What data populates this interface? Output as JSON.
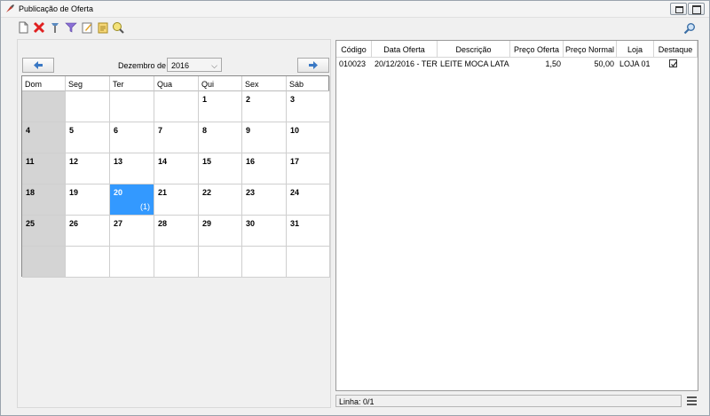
{
  "window": {
    "title": "Publicação de Oferta"
  },
  "toolbar": {
    "icons": [
      "new-document-icon",
      "delete-icon",
      "tools-icon",
      "filter-icon",
      "edit-icon",
      "export-icon",
      "search-settings-icon"
    ]
  },
  "calendar": {
    "month_label": "Dezembro de",
    "year": "2016",
    "day_headers": [
      "Dom",
      "Seg",
      "Ter",
      "Qua",
      "Qui",
      "Sex",
      "Sáb"
    ],
    "weeks": [
      [
        "",
        "",
        "",
        "",
        "1",
        "2",
        "3"
      ],
      [
        "4",
        "5",
        "6",
        "7",
        "8",
        "9",
        "10"
      ],
      [
        "11",
        "12",
        "13",
        "14",
        "15",
        "16",
        "17"
      ],
      [
        "18",
        "19",
        "20",
        "21",
        "22",
        "23",
        "24"
      ],
      [
        "25",
        "26",
        "27",
        "28",
        "29",
        "30",
        "31"
      ],
      [
        "",
        "",
        "",
        "",
        "",
        "",
        ""
      ]
    ],
    "selected_day": "20",
    "selected_count": "(1)",
    "colors": {
      "weekend_bg": "#d4d4d4",
      "selected_bg": "#3399ff"
    }
  },
  "grid": {
    "columns": [
      "Código",
      "Data Oferta",
      "Descrição",
      "Preço Oferta",
      "Preço Normal",
      "Loja",
      "Destaque"
    ],
    "rows": [
      {
        "codigo": "010023",
        "data": "20/12/2016 - TER",
        "descricao": "LEITE MOCA LATA",
        "preco_oferta": "1,50",
        "preco_normal": "50,00",
        "loja": "LOJA 01",
        "destaque": true
      }
    ]
  },
  "status": {
    "linha": "Linha: 0/1"
  }
}
